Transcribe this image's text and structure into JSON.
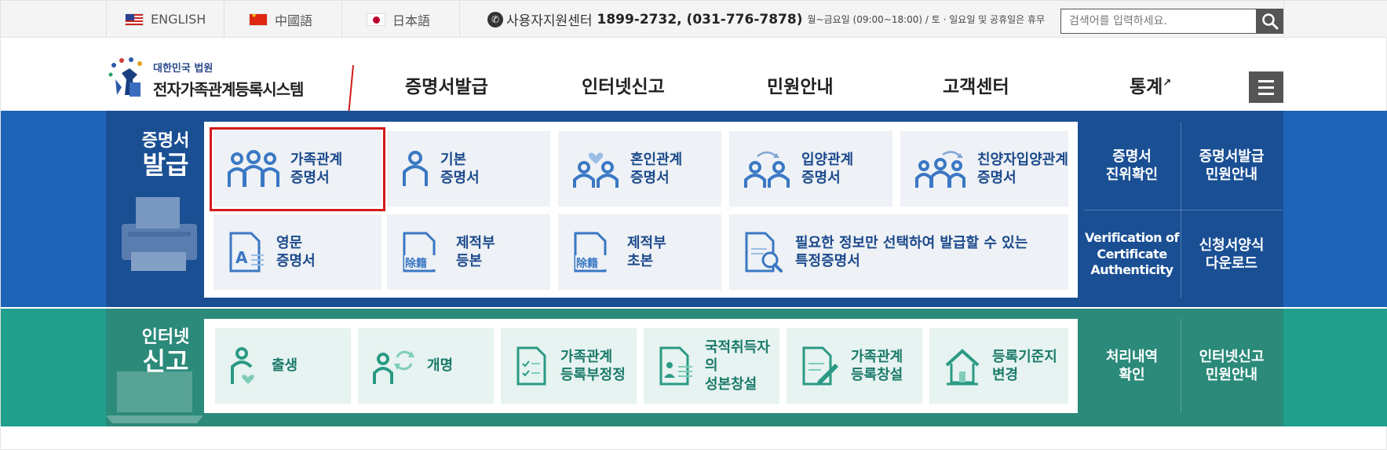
{
  "topbar": {
    "languages": [
      "ENGLISH",
      "中國語",
      "日本語"
    ],
    "support_label": "사용자지원센터",
    "support_numbers": "1899-2732, (031-776-7878)",
    "support_hours": "월~금요일 (09:00~18:00) / 토 · 일요일 및 공휴일은 휴무",
    "search_placeholder": "검색어를 입력하세요."
  },
  "header": {
    "logo_small": "대한민국 법원",
    "logo_big": "전자가족관계등록시스템",
    "nav": [
      "증명서발급",
      "인터넷신고",
      "민원안내",
      "고객센터",
      "통계"
    ]
  },
  "certificate": {
    "title_line1": "증명서",
    "title_line2": "발급",
    "tiles": [
      {
        "line1": "가족관계",
        "line2": "증명서",
        "icon": "family-icon"
      },
      {
        "line1": "기본",
        "line2": "증명서",
        "icon": "person-icon"
      },
      {
        "line1": "혼인관계",
        "line2": "증명서",
        "icon": "couple-heart-icon"
      },
      {
        "line1": "입양관계",
        "line2": "증명서",
        "icon": "adoption-icon"
      },
      {
        "line1": "친양자입양관계",
        "line2": "증명서",
        "icon": "family-adoption-icon"
      },
      {
        "line1": "영문",
        "line2": "증명서",
        "icon": "english-document-icon"
      },
      {
        "line1": "제적부",
        "line2": "등본",
        "icon": "removal-register-icon"
      },
      {
        "line1": "제적부",
        "line2": "초본",
        "icon": "removal-register-icon"
      },
      {
        "line1": "필요한 정보만 선택하여 발급할 수 있는",
        "line2": "특정증명서",
        "icon": "document-search-icon"
      }
    ],
    "side": [
      {
        "line1": "증명서",
        "line2": "진위확인"
      },
      {
        "line1": "증명서발급",
        "line2": "민원안내"
      },
      {
        "line1": "Verification of",
        "line2": "Certificate",
        "line3": "Authenticity"
      },
      {
        "line1": "신청서양식",
        "line2": "다운로드"
      }
    ]
  },
  "report": {
    "title_line1": "인터넷",
    "title_line2": "신고",
    "tiles": [
      {
        "line1": "출생",
        "line2": "",
        "icon": "birth-icon"
      },
      {
        "line1": "개명",
        "line2": "",
        "icon": "rename-icon"
      },
      {
        "line1": "가족관계",
        "line2": "등록부정정",
        "icon": "checklist-document-icon"
      },
      {
        "line1": "국적취득자의",
        "line2": "성본창설",
        "icon": "id-document-icon"
      },
      {
        "line1": "가족관계",
        "line2": "등록창설",
        "icon": "document-pen-icon"
      },
      {
        "line1": "등록기준지",
        "line2": "변경",
        "icon": "house-icon"
      }
    ],
    "side": [
      {
        "line1": "처리내역",
        "line2": "확인"
      },
      {
        "line1": "인터넷신고",
        "line2": "민원안내"
      }
    ]
  },
  "colors": {
    "blue_band": "#1a4f94",
    "green_band": "#2b8a7a",
    "highlight": "#d21a1a",
    "tile_text_blue": "#1c4a8c",
    "tile_text_green": "#1b7a6a"
  }
}
